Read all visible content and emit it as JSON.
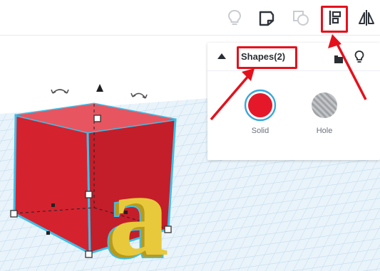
{
  "toolbar": {
    "buttons": [
      {
        "name": "light-bulb-icon",
        "state": "disabled"
      },
      {
        "name": "note-icon",
        "state": "enabled"
      },
      {
        "name": "group-icon",
        "state": "disabled"
      },
      {
        "name": "align-icon",
        "state": "active"
      },
      {
        "name": "mirror-icon",
        "state": "enabled"
      }
    ]
  },
  "panel": {
    "title": "Shapes(2)",
    "solid_label": "Solid",
    "hole_label": "Hole",
    "solid_color": "#e5182a",
    "hole_color": "#b7b9bc"
  },
  "colors": {
    "annotation": "#e4111c",
    "cube_front": "#d5222f",
    "cube_top": "#e75560",
    "cube_side": "#b11c27",
    "letter": "#e8c93b",
    "grid": "#b9d8ec",
    "selection": "#3fbfe6"
  }
}
